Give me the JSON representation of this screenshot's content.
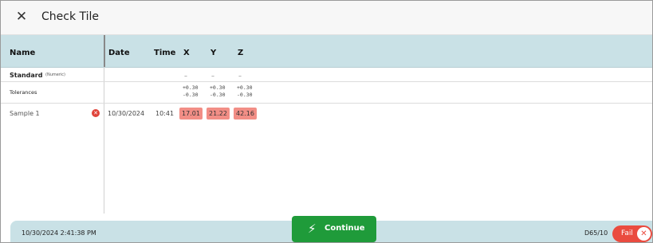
{
  "window": {
    "close_glyph": "✕",
    "title": "Check Tile"
  },
  "table": {
    "headers": {
      "name": "Name",
      "date": "Date",
      "time": "Time",
      "x": "X",
      "y": "Y",
      "z": "Z"
    },
    "standard": {
      "label": "Standard",
      "sub": "(Numeric)",
      "x": "–",
      "y": "–",
      "z": "–"
    },
    "tolerances": {
      "label": "Tolerances",
      "x_plus": "+0.30",
      "x_minus": "-0.30",
      "y_plus": "+0.30",
      "y_minus": "-0.30",
      "z_plus": "+0.30",
      "z_minus": "-0.30"
    },
    "samples": [
      {
        "name": "Sample 1",
        "status_glyph": "✕",
        "date": "10/30/2024",
        "time": "10:41",
        "x": "17.01",
        "y": "21.22",
        "z": "42.16"
      }
    ]
  },
  "footer": {
    "timestamp": "10/30/2024 2:41:38 PM",
    "continue_icon": "⚡",
    "continue_label": "Continue",
    "illuminant": "D65/10",
    "result_label": "Fail",
    "result_glyph": "✕"
  },
  "colors": {
    "header_bg": "#c9e1e6",
    "fail_red": "#ea4b3f",
    "value_red": "#f28e86",
    "continue_green": "#1f9b3a"
  }
}
